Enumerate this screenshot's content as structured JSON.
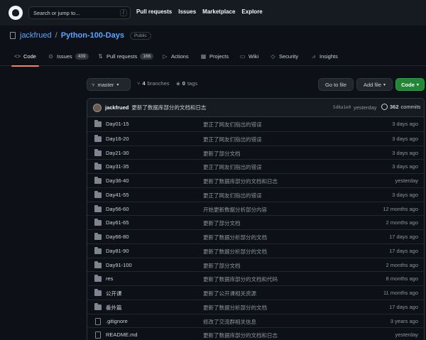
{
  "header": {
    "search_placeholder": "Search or jump to...",
    "search_key": "/",
    "nav": [
      "Pull requests",
      "Issues",
      "Marketplace",
      "Explore"
    ]
  },
  "repo": {
    "owner": "jackfrued",
    "name": "Python-100-Days",
    "visibility": "Public"
  },
  "tabs": [
    {
      "label": "Code",
      "icon": "code-icon",
      "count": ""
    },
    {
      "label": "Issues",
      "icon": "issue-icon",
      "count": "439"
    },
    {
      "label": "Pull requests",
      "icon": "pull-request-icon",
      "count": "166"
    },
    {
      "label": "Actions",
      "icon": "play-icon",
      "count": ""
    },
    {
      "label": "Projects",
      "icon": "table-icon",
      "count": ""
    },
    {
      "label": "Wiki",
      "icon": "book-icon",
      "count": ""
    },
    {
      "label": "Security",
      "icon": "shield-icon",
      "count": ""
    },
    {
      "label": "Insights",
      "icon": "graph-icon",
      "count": ""
    }
  ],
  "toolbar": {
    "branch": "master",
    "branches_count": "4",
    "branches_label": "branches",
    "tags_count": "0",
    "tags_label": "tags",
    "goto_file": "Go to file",
    "add_file": "Add file",
    "code": "Code"
  },
  "latest_commit": {
    "author": "jackfrued",
    "message": "更新了数据库部分的文档和日志",
    "sha": "5d8a1e0",
    "time": "yesterday",
    "commits_count": "362",
    "commits_label": "commits"
  },
  "files": [
    {
      "type": "folder",
      "name": "Day01-15",
      "message": "更正了网友们指出的错误",
      "age": "3 days ago"
    },
    {
      "type": "folder",
      "name": "Day16-20",
      "message": "更正了网友们指出的错误",
      "age": "3 days ago"
    },
    {
      "type": "folder",
      "name": "Day21-30",
      "message": "更新了部分文档",
      "age": "3 days ago"
    },
    {
      "type": "folder",
      "name": "Day31-35",
      "message": "更正了网友们指出的错误",
      "age": "3 days ago"
    },
    {
      "type": "folder",
      "name": "Day36-40",
      "message": "更新了数据库部分的文档和日志",
      "age": "yesterday"
    },
    {
      "type": "folder",
      "name": "Day41-55",
      "message": "更正了网友们指出的错误",
      "age": "3 days ago"
    },
    {
      "type": "folder",
      "name": "Day56-60",
      "message": "开始更新数据分析部分内容",
      "age": "12 months ago"
    },
    {
      "type": "folder",
      "name": "Day61-65",
      "message": "更新了部分文档",
      "age": "2 months ago"
    },
    {
      "type": "folder",
      "name": "Day66-80",
      "message": "更新了数据分析部分的文档",
      "age": "17 days ago"
    },
    {
      "type": "folder",
      "name": "Day81-90",
      "message": "更新了数据分析部分的文档",
      "age": "17 days ago"
    },
    {
      "type": "folder",
      "name": "Day91-100",
      "message": "更新了部分文档",
      "age": "2 months ago"
    },
    {
      "type": "folder",
      "name": "res",
      "message": "更新了数据库部分的文档和代码",
      "age": "8 months ago"
    },
    {
      "type": "folder",
      "name": "公开课",
      "message": "更新了公开课相关资源",
      "age": "11 months ago"
    },
    {
      "type": "folder",
      "name": "番外篇",
      "message": "更新了数据分析部分的文档",
      "age": "17 days ago"
    },
    {
      "type": "file",
      "name": ".gitignore",
      "message": "修改了交流群相关信息",
      "age": "3 years ago"
    },
    {
      "type": "file",
      "name": "README.md",
      "message": "更新了数据库部分的文档和日志",
      "age": "yesterday"
    }
  ]
}
